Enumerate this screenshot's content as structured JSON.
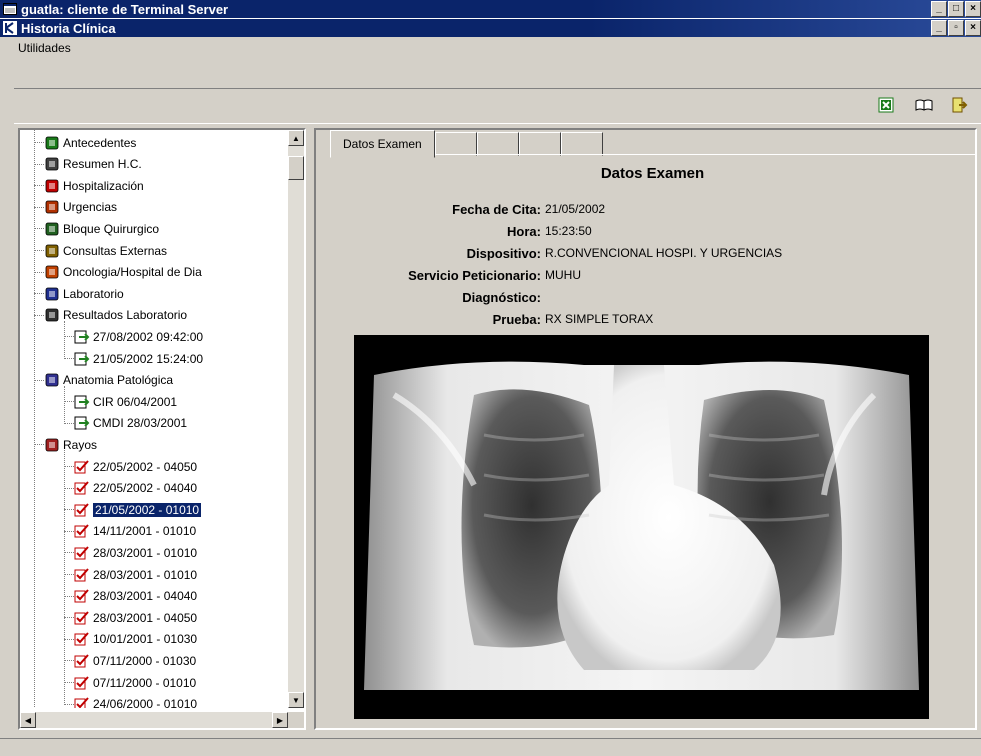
{
  "outer_window": {
    "title": "guatla: cliente de Terminal Server",
    "buttons": [
      "_",
      "□",
      "×"
    ]
  },
  "inner_window": {
    "title": "Historia Clínica",
    "buttons": [
      "_",
      "▫",
      "×"
    ]
  },
  "menu": {
    "items": [
      "Utilidades"
    ]
  },
  "toolbar": {
    "icons": [
      "excel-icon",
      "book-icon",
      "exit-icon"
    ]
  },
  "tree": {
    "items": [
      {
        "label": "Antecedentes",
        "icon": "antecedentes-icon",
        "color": "#1a7a1a",
        "level": 0
      },
      {
        "label": "Resumen H.C.",
        "icon": "resumen-icon",
        "color": "#404040",
        "level": 0
      },
      {
        "label": "Hospitalización",
        "icon": "hospital-icon",
        "color": "#c00000",
        "level": 0
      },
      {
        "label": "Urgencias",
        "icon": "urgencias-icon",
        "color": "#b03000",
        "level": 0
      },
      {
        "label": "Bloque Quirurgico",
        "icon": "quirurgico-icon",
        "color": "#206020",
        "level": 0
      },
      {
        "label": "Consultas Externas",
        "icon": "consultas-icon",
        "color": "#806000",
        "level": 0
      },
      {
        "label": "Oncologia/Hospital de Dia",
        "icon": "oncologia-icon",
        "color": "#c04000",
        "level": 0
      },
      {
        "label": "Laboratorio",
        "icon": "laboratorio-icon",
        "color": "#203090",
        "level": 0
      },
      {
        "label": "Resultados Laboratorio",
        "icon": "resultados-icon",
        "color": "#303030",
        "level": 0
      },
      {
        "label": "27/08/2002 09:42:00",
        "icon": "document-arrow-icon",
        "color": "#208020",
        "level": 1
      },
      {
        "label": "21/05/2002 15:24:00",
        "icon": "document-arrow-icon",
        "color": "#208020",
        "level": 1
      },
      {
        "label": "Anatomia Patológica",
        "icon": "microscope-icon",
        "color": "#303090",
        "level": 0
      },
      {
        "label": "CIR 06/04/2001",
        "icon": "document-arrow-icon",
        "color": "#208020",
        "level": 1
      },
      {
        "label": "CMDI 28/03/2001",
        "icon": "document-arrow-icon",
        "color": "#208020",
        "level": 1
      },
      {
        "label": "Rayos",
        "icon": "rayos-icon",
        "color": "#a02020",
        "level": 0
      },
      {
        "label": "22/05/2002 - 04050",
        "icon": "xray-check-icon",
        "color": "#c00000",
        "level": 1
      },
      {
        "label": "22/05/2002 - 04040",
        "icon": "xray-check-icon",
        "color": "#c00000",
        "level": 1
      },
      {
        "label": "21/05/2002 - 01010",
        "icon": "xray-check-icon",
        "color": "#c00000",
        "level": 1,
        "selected": true
      },
      {
        "label": "14/11/2001 - 01010",
        "icon": "xray-check-icon",
        "color": "#c00000",
        "level": 1
      },
      {
        "label": "28/03/2001 - 01010",
        "icon": "xray-check-icon",
        "color": "#c00000",
        "level": 1
      },
      {
        "label": "28/03/2001 - 01010",
        "icon": "xray-check-icon",
        "color": "#c00000",
        "level": 1
      },
      {
        "label": "28/03/2001 - 04040",
        "icon": "xray-check-icon",
        "color": "#c00000",
        "level": 1
      },
      {
        "label": "28/03/2001 - 04050",
        "icon": "xray-check-icon",
        "color": "#c00000",
        "level": 1
      },
      {
        "label": "10/01/2001 - 01030",
        "icon": "xray-check-icon",
        "color": "#c00000",
        "level": 1
      },
      {
        "label": "07/11/2000 - 01030",
        "icon": "xray-check-icon",
        "color": "#c00000",
        "level": 1
      },
      {
        "label": "07/11/2000 - 01010",
        "icon": "xray-check-icon",
        "color": "#c00000",
        "level": 1
      },
      {
        "label": "24/06/2000 - 01010",
        "icon": "xray-check-icon",
        "color": "#c00000",
        "level": 1
      }
    ]
  },
  "tabs": [
    {
      "label": "Datos Examen",
      "active": true
    },
    {
      "label": ""
    },
    {
      "label": ""
    },
    {
      "label": ""
    },
    {
      "label": ""
    }
  ],
  "exam": {
    "title": "Datos Examen",
    "fields": [
      {
        "label": "Fecha de Cita:",
        "value": "21/05/2002"
      },
      {
        "label": "Hora:",
        "value": "15:23:50"
      },
      {
        "label": "Dispositivo:",
        "value": "R.CONVENCIONAL HOSPI. Y URGENCIAS"
      },
      {
        "label": "Servicio Peticionario:",
        "value": "MUHU"
      },
      {
        "label": "Diagnóstico:",
        "value": ""
      },
      {
        "label": "Prueba:",
        "value": "RX SIMPLE TORAX"
      }
    ]
  },
  "colors": {
    "selection": "#0a246a",
    "titlebar": "#0a246a",
    "window_bg": "#d4d0c8"
  }
}
